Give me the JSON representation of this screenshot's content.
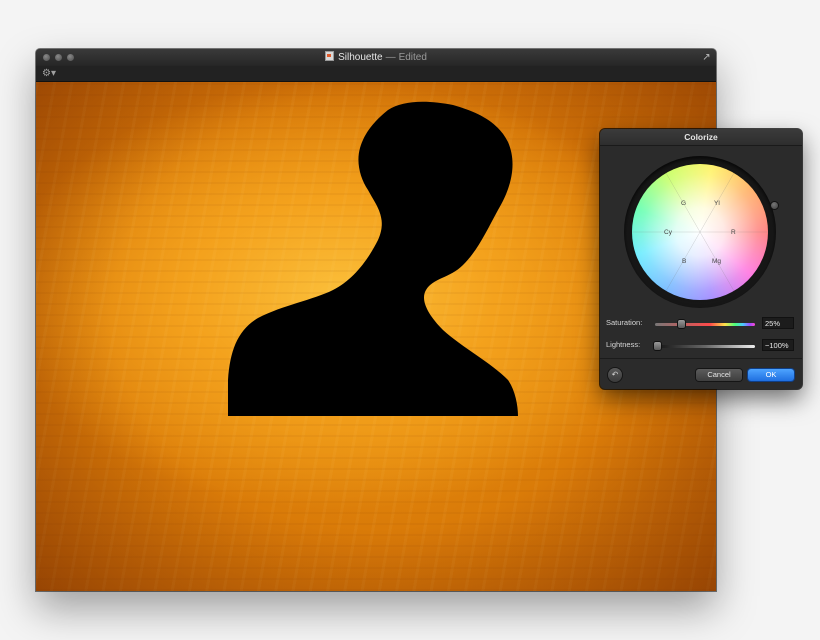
{
  "window": {
    "title": "Silhouette",
    "separator": "—",
    "status": "Edited",
    "icons": {
      "close": "traffic-light-icon",
      "fullscreen": "fullscreen-icon",
      "gear": "gear-icon"
    }
  },
  "canvas": {
    "image": "silhouette-bust-on-orange-texture",
    "background_color": "#f0a019",
    "silhouette_color": "#000000"
  },
  "colorize_panel": {
    "title": "Colorize",
    "wheel_labels": {
      "g": "G",
      "yl": "Yl",
      "cy": "Cy",
      "r": "R",
      "b": "B",
      "mg": "Mg"
    },
    "saturation": {
      "label": "Saturation:",
      "value": "25%",
      "level": 0.25
    },
    "lightness": {
      "label": "Lightness:",
      "value": "−100%",
      "level": 0.0
    },
    "reset_icon": "undo-icon",
    "cancel_label": "Cancel",
    "ok_label": "OK",
    "accent": "#2f85f0"
  }
}
